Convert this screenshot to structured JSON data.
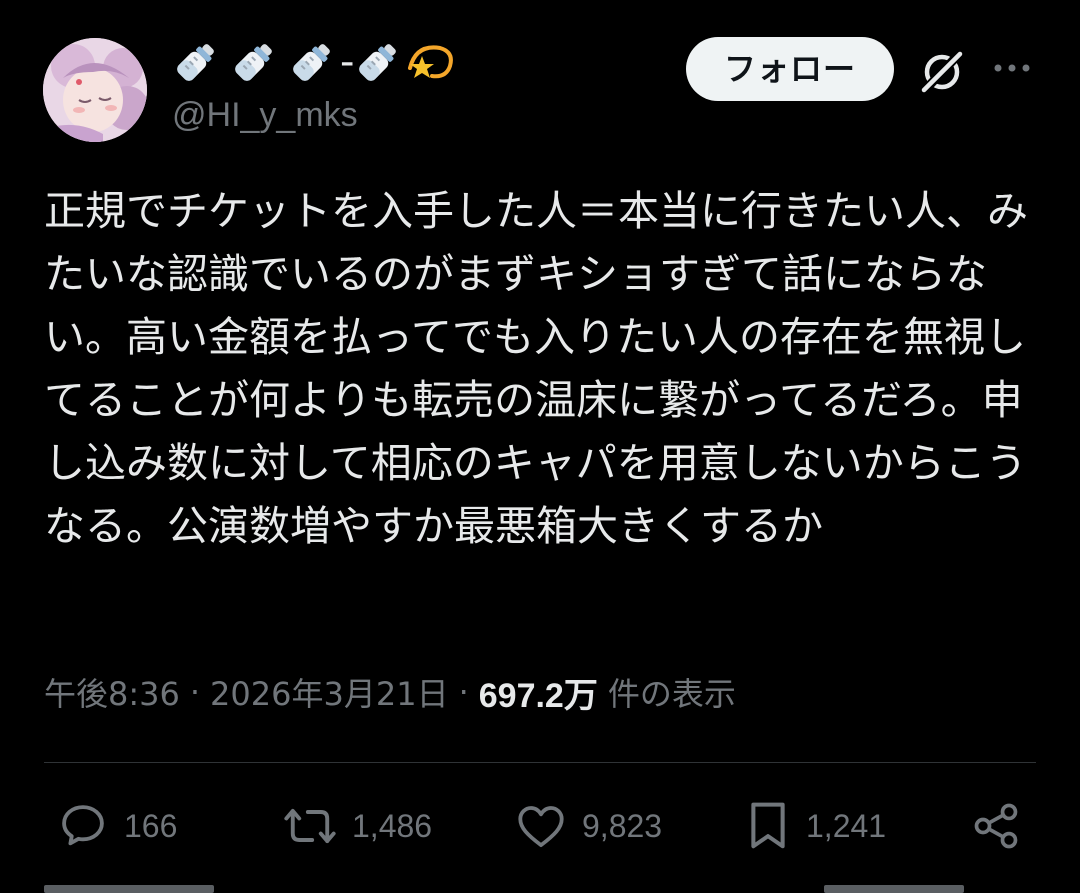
{
  "author": {
    "display_name_suffix": "💫",
    "handle": "@HI_y_mks",
    "avatar": "avatar-illustration"
  },
  "header": {
    "follow_label": "フォロー",
    "grok_icon": "grok-icon",
    "more_icon": "more-icon"
  },
  "tweet": {
    "text": "正規でチケットを入手した人＝本当に行きたい人、みたいな認識でいるのがまずキショすぎて話にならない。高い金額を払ってでも入りたい人の存在を無視してることが何よりも転売の温床に繋がってるだろ。申し込み数に対して相応のキャパを用意しないからこうなる。公演数増やすか最悪箱大きくするか"
  },
  "meta": {
    "time": "午後8:36",
    "separator": "·",
    "date": "2026年3月21日",
    "views_count": "697.2万",
    "views_label": "件の表示"
  },
  "actions": {
    "replies": "166",
    "reposts": "1,486",
    "likes": "9,823",
    "bookmarks": "1,241"
  },
  "colors": {
    "background": "#000000",
    "text_primary": "#e7e9ea",
    "text_secondary": "#71767b",
    "divider": "#2f3336",
    "follow_bg": "#eff3f4"
  }
}
